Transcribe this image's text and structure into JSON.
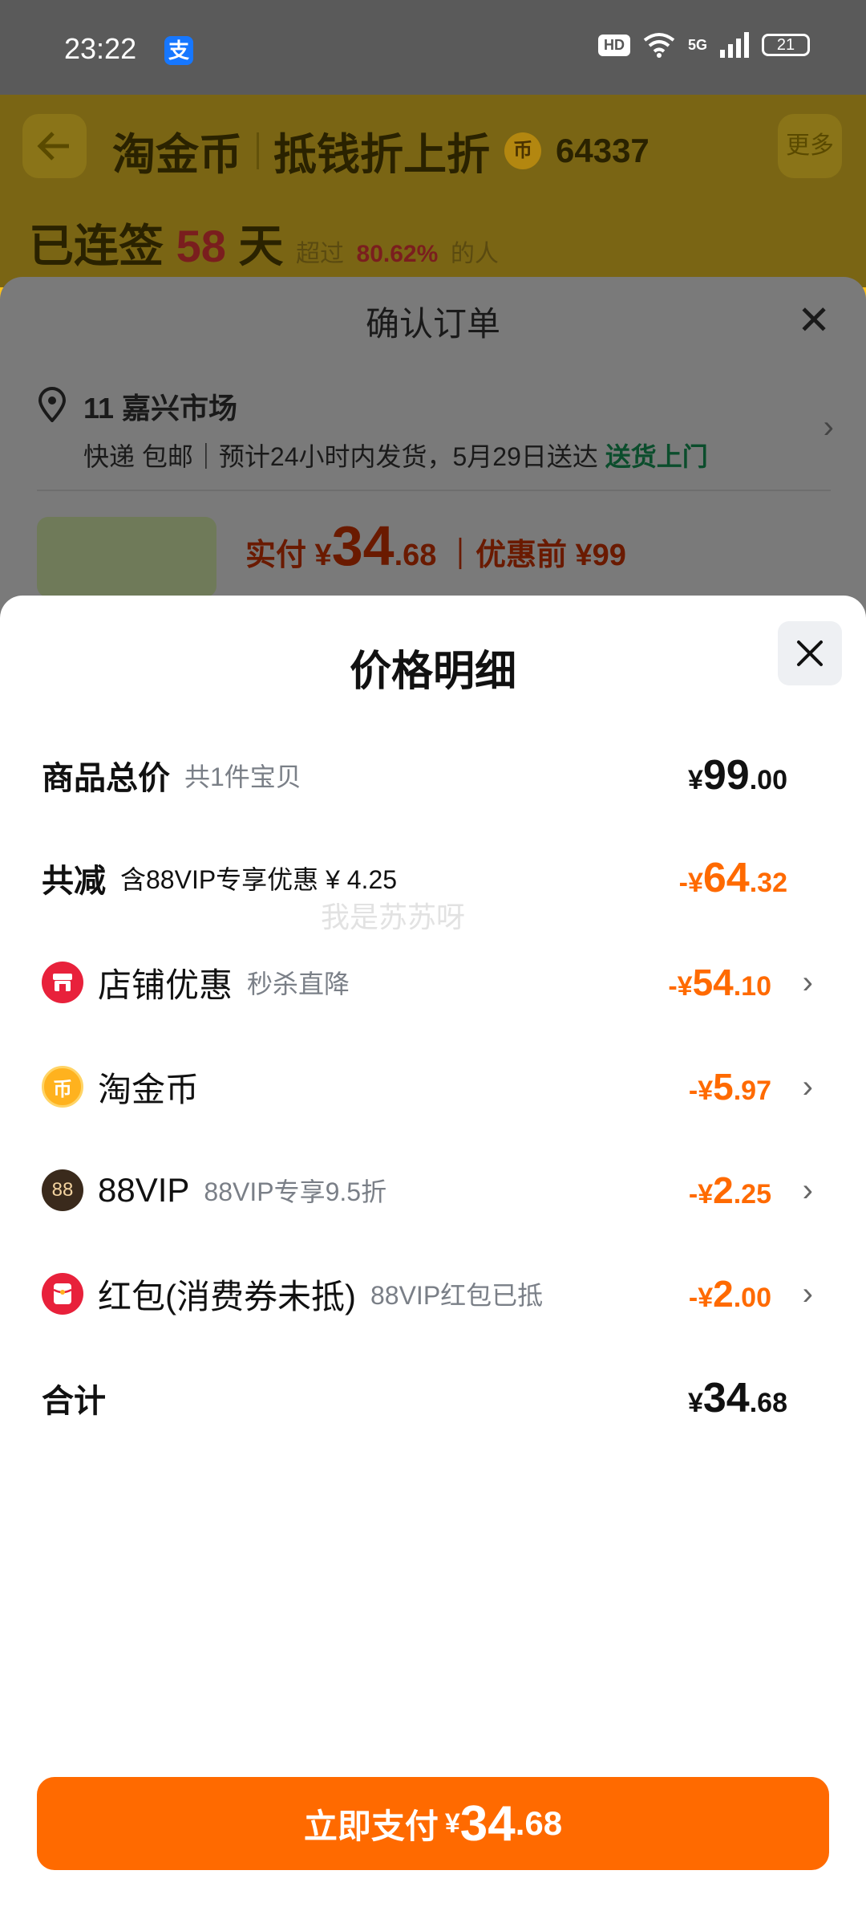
{
  "status_bar": {
    "time": "23:22",
    "alipay_glyph": "支",
    "hd": "HD",
    "network": "5G",
    "battery": "21"
  },
  "background": {
    "title": "淘金币",
    "subtitle": "抵钱折上折",
    "coin_glyph": "币",
    "coin_count": "64337",
    "more": "更多",
    "streak_prefix": "已连签",
    "streak_days": "58",
    "streak_suffix": "天",
    "exceed_prefix": "超过",
    "exceed_pct": "80.62%",
    "exceed_suffix": "的人",
    "order_title": "确认订单",
    "address": "11 嘉兴市场",
    "shipping": "快递 包邮｜预计24小时内发货，5月29日送达",
    "delivery_tag": "送货上门",
    "paid_prefix": "实付 ¥",
    "paid_int": "34",
    "paid_dec": ".68",
    "before_discount": "｜优惠前 ¥99"
  },
  "sheet": {
    "title": "价格明细",
    "watermark": "我是苏苏呀",
    "total_goods": {
      "label": "商品总价",
      "sub": "共1件宝贝",
      "cur": "¥",
      "int": "99",
      "dec": ".00"
    },
    "total_reduce": {
      "label": "共减",
      "sub": "含88VIP专享优惠 ¥ 4.25",
      "cur": "-¥",
      "int": "64",
      "dec": ".32"
    },
    "items": [
      {
        "label": "店铺优惠",
        "sub": "秒杀直降",
        "cur": "-¥",
        "int": "54",
        "dec": ".10",
        "icon": "shop-icon"
      },
      {
        "label": "淘金币",
        "sub": "",
        "cur": "-¥",
        "int": "5",
        "dec": ".97",
        "icon": "coin-icon",
        "glyph": "币"
      },
      {
        "label": "88VIP",
        "sub": "88VIP专享9.5折",
        "cur": "-¥",
        "int": "2",
        "dec": ".25",
        "icon": "vip-88-icon",
        "glyph": "88"
      },
      {
        "label": "红包(消费券未抵)",
        "sub": "88VIP红包已抵",
        "cur": "-¥",
        "int": "2",
        "dec": ".00",
        "icon": "red-packet-icon"
      }
    ],
    "sum": {
      "label": "合计",
      "cur": "¥",
      "int": "34",
      "dec": ".68"
    },
    "pay_button": {
      "label": "立即支付",
      "cur": "¥",
      "int": "34",
      "dec": ".68"
    }
  },
  "colors": {
    "accent": "#ff6a00",
    "text": "#111111",
    "muted": "#7a7f87"
  }
}
